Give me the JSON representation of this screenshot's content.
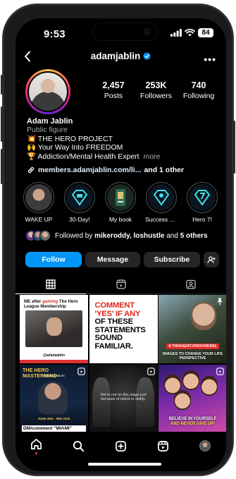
{
  "status_bar": {
    "time": "9:53",
    "battery": "84"
  },
  "header": {
    "username": "adamjablin",
    "verified": true
  },
  "stats": [
    {
      "value": "2,457",
      "label": "Posts"
    },
    {
      "value": "253K",
      "label": "Followers"
    },
    {
      "value": "740",
      "label": "Following"
    }
  ],
  "bio": {
    "name": "Adam  Jablin",
    "category": "Public figure",
    "lines": [
      "💥 THE HERO PROJECT",
      "🙌 Your Way Into FREEDOM",
      "🏆 Addiction/Mental Health Expert"
    ],
    "more": "more",
    "link": "members.adamjablin.com/li...",
    "link_suffix": "and 1 other"
  },
  "highlights": [
    {
      "label": "WAKE UP"
    },
    {
      "label": "30-Day!"
    },
    {
      "label": "My book"
    },
    {
      "label": "Success St..."
    },
    {
      "label": "Hero 7!"
    }
  ],
  "followed_by": {
    "prefix": "Followed by ",
    "names": "mikeroddy, loshustle",
    "mid": " and ",
    "others": "5 others"
  },
  "buttons": {
    "follow": "Follow",
    "message": "Message",
    "subscribe": "Subscribe"
  },
  "posts": {
    "p1": {
      "header_a": "ME after ",
      "header_hl": "gaining",
      "header_b": " The Hero League Membership",
      "caption": "@adamjablin"
    },
    "p2": {
      "line1": "COMMENT",
      "line2": "'YES' IF ANY",
      "line3": "OF THESE",
      "line4": "STATEMENTS",
      "line5": "SOUND",
      "line6": "FAMILIAR."
    },
    "p3": {
      "badge": "8 THOUGHT-PROVOKING",
      "sub": "IMAGES TO CHANGE YOUR LIFE PERSPECTIVE"
    },
    "p4": {
      "title": "THE HERO MASTERMIND",
      "sub": "ADAM JABLIN",
      "dates": "JUNE 2ND - 3RD 2025",
      "dm": "DM/comment \"MIAMI\""
    },
    "p5": {
      "text": "We're not on this stage just because of talent or ability."
    },
    "p6": {
      "line1": "BELIEVE IN YOURSELF",
      "line2": "AND NEVER GIVE UP!"
    }
  },
  "colors": {
    "accent": "#0095f6",
    "button_bg": "#262626",
    "secondary_text": "#a8a8a8"
  }
}
